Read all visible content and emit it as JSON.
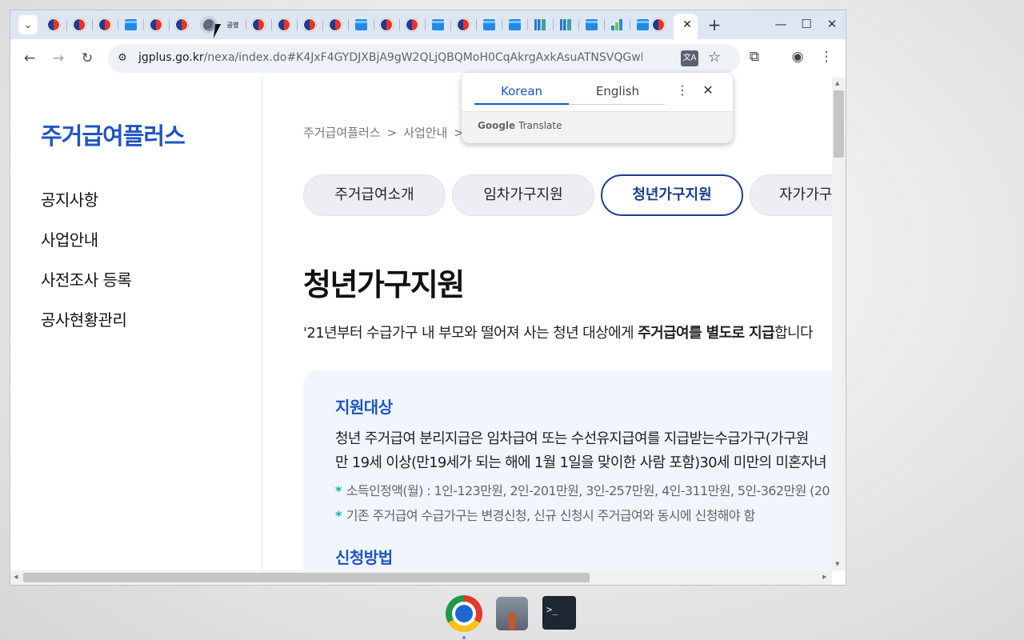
{
  "browser": {
    "url_host": "jgplus.go.kr",
    "url_rest": "/nexa/index.do#K4JxF4GYDJXBjA9gW2QLjQBQMoH0CqAkrgAxkAsuATNSVQGwB0...",
    "tab_close": "✕",
    "new_tab": "+",
    "window_controls": {
      "minimize": "—",
      "maximize": "☐",
      "close": "✕"
    },
    "nav": {
      "back": "←",
      "forward": "→",
      "reload": "↻"
    },
    "gov_tab_text": "공명"
  },
  "translate_popup": {
    "tab_source": "Korean",
    "tab_target": "English",
    "more": "⋮",
    "close": "✕",
    "brand_google": "Google",
    "brand_translate": "Translate"
  },
  "sidebar": {
    "logo": "주거급여플러스",
    "items": [
      {
        "label": "공지사항"
      },
      {
        "label": "사업안내"
      },
      {
        "label": "사전조사 등록"
      },
      {
        "label": "공사현황관리"
      }
    ]
  },
  "main": {
    "breadcrumb": [
      "주거급여플러스",
      "사업안내"
    ],
    "tabs": [
      {
        "label": "주거급여소개",
        "active": false
      },
      {
        "label": "임차가구지원",
        "active": false
      },
      {
        "label": "청년가구지원",
        "active": true
      },
      {
        "label": "자가가구",
        "active": false
      }
    ],
    "title": "청년가구지원",
    "lead_prefix": "'21년부터 수급가구 내 부모와 떨어져 사는 청년 대상에게 ",
    "lead_bold": "주거급여를 별도로 지급",
    "lead_suffix": "합니다",
    "section1_title": "지원대상",
    "section1_line1": "청년 주거급여 분리지급은 임차급여 또는 수선유지급여를 지급받는수급가구(가구원",
    "section1_line2": "만 19세 이상(만19세가 되는 해에 1월 1일을 맞이한 사람 포함)30세 미만의 미혼자녀",
    "note_marker": "*",
    "note1": "소득인정액(월) : 1인-123만원, 2인-201만원, 3인-257만원, 4인-311만원, 5인-362만원 (20",
    "note2": "기존 주거급여 수급가구는 변경신청, 신규 신청시 주거급여와 동시에 신청해야 함",
    "section2_title": "신청방법"
  },
  "colors": {
    "brand_blue": "#1e55c2",
    "active_tab_navy": "#1b3f86",
    "note_teal": "#14b3b0",
    "box_bg": "#f1f5fd"
  }
}
